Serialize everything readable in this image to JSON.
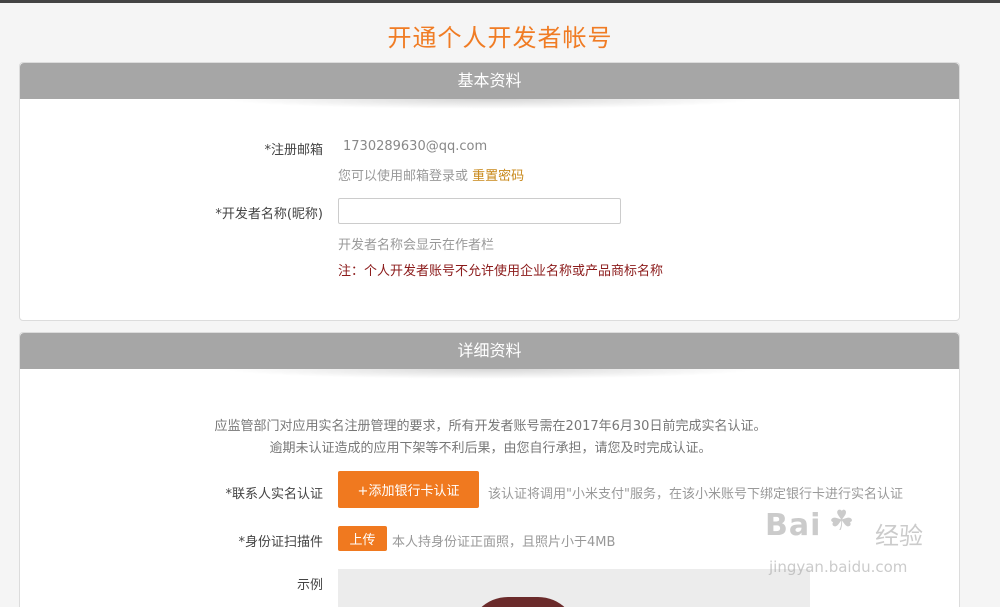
{
  "page": {
    "title": "开通个人开发者帐号"
  },
  "basic": {
    "header": "基本资料",
    "email_label": "*注册邮箱",
    "email_value": "1730289630@qq.com",
    "email_hint": "您可以使用邮箱登录或",
    "reset_password_link": "重置密码",
    "dev_name_label": "*开发者名称(昵称)",
    "dev_name_value": "",
    "dev_name_hint": "开发者名称会显示在作者栏",
    "dev_name_warning": "注：个人开发者账号不允许使用企业名称或产品商标名称"
  },
  "detail": {
    "header": "详细资料",
    "notice_line1": "应监管部门对应用实名注册管理的要求，所有开发者账号需在2017年6月30日前完成实名认证。",
    "notice_line2": "逾期未认证造成的应用下架等不利后果，由您自行承担，请您及时完成认证。",
    "realname_label": "*联系人实名认证",
    "add_bank_card_button": "+添加银行卡认证",
    "realname_hint": "该认证将调用\"小米支付\"服务，在该小米账号下绑定银行卡进行实名认证",
    "id_scan_label": "*身份证扫描件",
    "upload_button": "上传",
    "id_scan_hint": "本人持身份证正面照，且照片小于4MB",
    "example_label": "示例"
  },
  "watermark": {
    "brand": "Bai",
    "brand_suffix": "经验",
    "url": "jingyan.baidu.com"
  },
  "colors": {
    "accent": "#f07c24",
    "header_bg": "#a6a6a6",
    "warning": "#8b1a1a",
    "link": "#c8881a"
  }
}
